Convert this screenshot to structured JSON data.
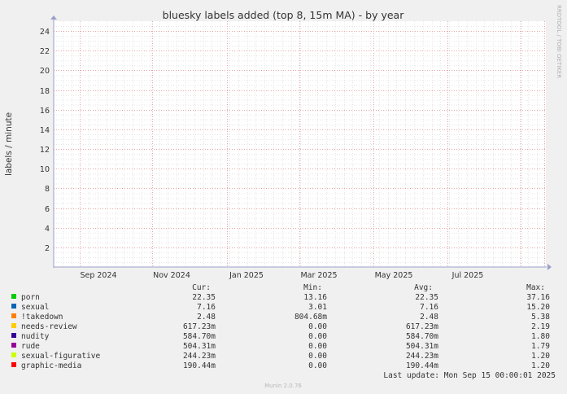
{
  "chart_data": {
    "type": "line",
    "title": "bluesky labels added (top 8, 15m MA) - by year",
    "ylabel": "labels / minute",
    "ylim": [
      0,
      25
    ],
    "yticks": [
      2,
      4,
      6,
      8,
      10,
      12,
      14,
      16,
      18,
      20,
      22,
      24
    ],
    "x_tick_labels": [
      "Sep 2024",
      "Nov 2024",
      "Jan 2025",
      "Mar 2025",
      "May 2025",
      "Jul 2025"
    ],
    "grid": true,
    "legend_placement": "bottom",
    "columns": {
      "cur": "Cur:",
      "min": "Min:",
      "avg": "Avg:",
      "max": "Max:"
    },
    "series": [
      {
        "name": "porn",
        "color": "#00cc00",
        "cur": "22.35",
        "min": "13.16",
        "avg": "22.35",
        "max": "37.16"
      },
      {
        "name": "sexual",
        "color": "#0066b3",
        "cur": "7.16",
        "min": "3.01",
        "avg": "7.16",
        "max": "15.20"
      },
      {
        "name": "!takedown",
        "color": "#ff8000",
        "cur": "2.48",
        "min": "804.68m",
        "avg": "2.48",
        "max": "5.38"
      },
      {
        "name": "needs-review",
        "color": "#ffcc00",
        "cur": "617.23m",
        "min": "0.00",
        "avg": "617.23m",
        "max": "2.19"
      },
      {
        "name": "nudity",
        "color": "#330099",
        "cur": "584.70m",
        "min": "0.00",
        "avg": "584.70m",
        "max": "1.80"
      },
      {
        "name": "rude",
        "color": "#990099",
        "cur": "504.31m",
        "min": "0.00",
        "avg": "504.31m",
        "max": "1.79"
      },
      {
        "name": "sexual-figurative",
        "color": "#ccff00",
        "cur": "244.23m",
        "min": "0.00",
        "avg": "244.23m",
        "max": "1.20"
      },
      {
        "name": "graphic-media",
        "color": "#ff0000",
        "cur": "190.44m",
        "min": "0.00",
        "avg": "190.44m",
        "max": "1.20"
      }
    ],
    "last_update": "Last update: Mon Sep 15 00:00:01 2025"
  },
  "side_label": "RRDTOOL / TOBI OETIKER",
  "footer": "Munin 2.0.76"
}
